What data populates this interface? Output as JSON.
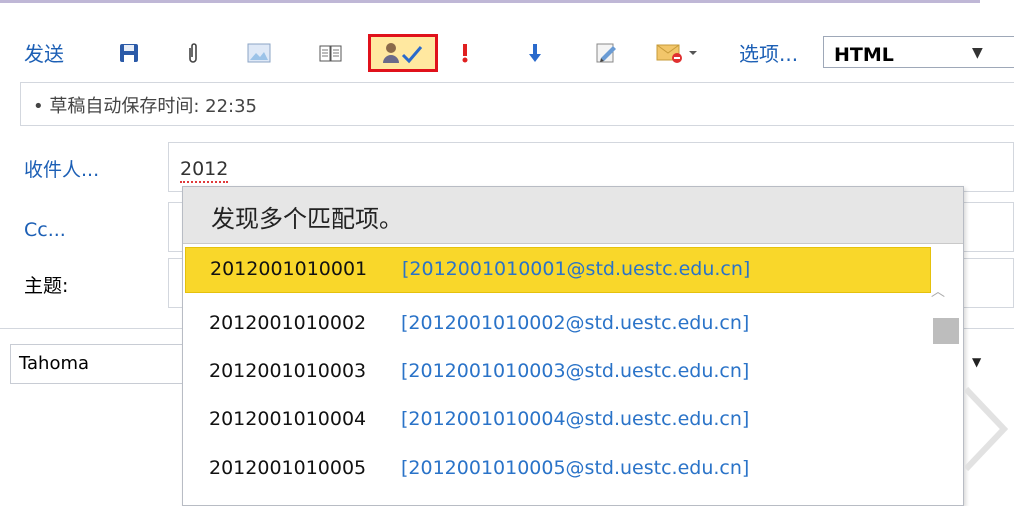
{
  "toolbar": {
    "send_label": "发送",
    "options_label": "选项...",
    "format_value": "HTML",
    "icons": [
      "save-icon",
      "attach-icon",
      "picture-icon",
      "address-book-icon",
      "check-names-icon",
      "high-importance-icon",
      "low-importance-icon",
      "signature-icon",
      "flag-icon"
    ]
  },
  "draft": {
    "text": "• 草稿自动保存时间: 22:35"
  },
  "fields": {
    "to_label": "收件人...",
    "to_value": "2012",
    "cc_label": "Cc...",
    "subject_label": "主题:"
  },
  "format_bar": {
    "font": "Tahoma"
  },
  "popup": {
    "title": "发现多个匹配项。",
    "matches": [
      {
        "name": "2012001010001",
        "email": "[2012001010001@std.uestc.edu.cn]",
        "selected": true
      },
      {
        "name": "2012001010002",
        "email": "[2012001010002@std.uestc.edu.cn]",
        "selected": false
      },
      {
        "name": "2012001010003",
        "email": "[2012001010003@std.uestc.edu.cn]",
        "selected": false
      },
      {
        "name": "2012001010004",
        "email": "[2012001010004@std.uestc.edu.cn]",
        "selected": false
      },
      {
        "name": "2012001010005",
        "email": "[2012001010005@std.uestc.edu.cn]",
        "selected": false
      }
    ]
  },
  "colors": {
    "link_blue": "#1c5fb5",
    "email_blue": "#2a73c8",
    "selected_row": "#f9d72a",
    "highlight_border": "#e0111b"
  }
}
